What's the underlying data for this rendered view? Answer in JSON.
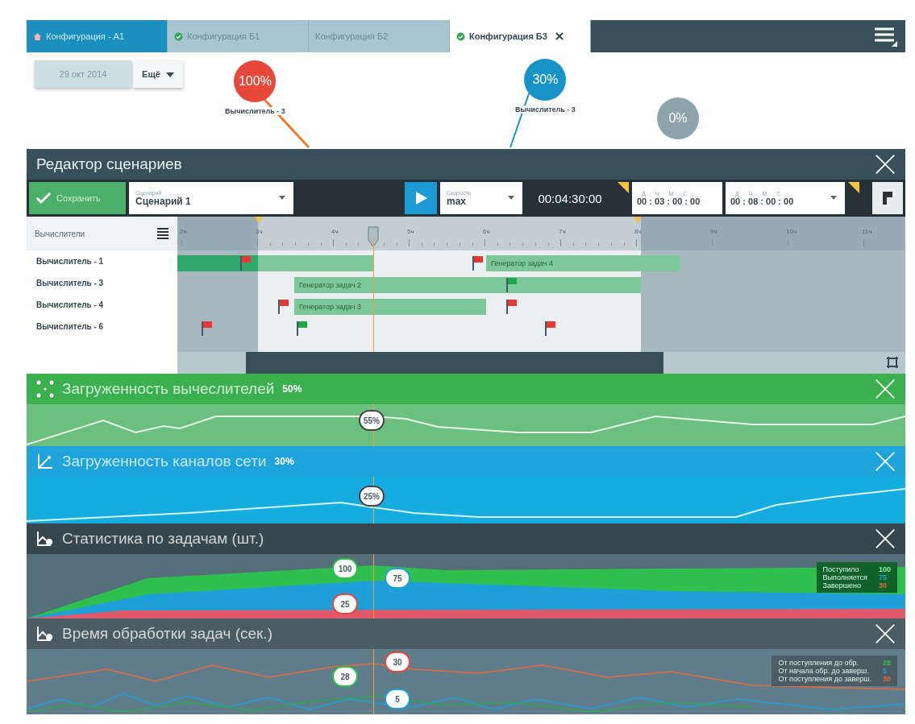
{
  "tabs": [
    {
      "label": "Конфигурация - А1",
      "kind": "alert",
      "selected": false,
      "closable": false
    },
    {
      "label": "Конфигурация Б1",
      "kind": "ok",
      "selected": false,
      "closable": false
    },
    {
      "label": "Конфигурация Б2",
      "kind": "none",
      "selected": false,
      "closable": false
    },
    {
      "label": "Конфигурация Б3",
      "kind": "ok",
      "selected": true,
      "closable": true
    }
  ],
  "date_button": "29 окт 2014",
  "more_button": "Ещё",
  "markers": [
    {
      "value": "100%",
      "label": "Вычислитель - 3",
      "color": "#e8483b"
    },
    {
      "value": "30%",
      "label": "Вычислитель - 3",
      "color": "#1793c8"
    },
    {
      "value": "0%",
      "color": "#8fa3ad"
    }
  ],
  "editor": {
    "title": "Редактор сценариев",
    "save_button": "Сохранить",
    "scenario": {
      "label": "Сценарий",
      "value": "Сценарий 1"
    },
    "speed": {
      "label": "Скорость",
      "value": "max"
    },
    "elapsed": "00:04:30:00",
    "range_start_units": [
      "Д",
      "Ч",
      "М",
      "С"
    ],
    "range_end_units": [
      "Д",
      "Ч",
      "М",
      "С"
    ],
    "range_start": "00 : 03 : 00 : 00",
    "range_end": "00 : 08 : 00 : 00",
    "list_header": "Вычислители",
    "hours": [
      "2ч",
      "3ч",
      "4ч",
      "5ч",
      "6ч",
      "7ч",
      "8ч",
      "9ч",
      "10ч",
      "11ч"
    ],
    "rows": [
      {
        "name": "Вычислитель - 1",
        "bars": [
          {
            "kind": "dark"
          },
          {
            "kind": "light"
          },
          {
            "kind": "light",
            "label": "Генератор задач 4"
          }
        ],
        "flags": [
          {
            "color": "#e53935"
          },
          {
            "color": "#e53935"
          }
        ]
      },
      {
        "name": "Вычислитель - 3",
        "bars": [
          {
            "kind": "light",
            "label": "Генератор задач 2"
          }
        ],
        "flags": [
          {
            "color": "#1ea84a"
          }
        ]
      },
      {
        "name": "Вычислитель - 4",
        "bars": [
          {
            "kind": "light",
            "label": "Генератор задач 3"
          }
        ],
        "flags": [
          {
            "color": "#e53935"
          },
          {
            "color": "#e53935"
          }
        ]
      },
      {
        "name": "Вычислитель - 6",
        "bars": [],
        "flags": [
          {
            "color": "#e53935"
          },
          {
            "color": "#1ea84a"
          },
          {
            "color": "#e53935"
          }
        ]
      }
    ]
  },
  "panels": [
    {
      "kind": "cpu",
      "title": "Загруженность вычеслителей",
      "value": "50%",
      "points": [
        "55%"
      ]
    },
    {
      "kind": "net",
      "title": "Загруженность каналов сети",
      "value": "30%",
      "points": [
        "25%"
      ]
    },
    {
      "kind": "tasks",
      "title": "Статистика по задачам (шт.)",
      "points": [
        "100",
        "75",
        "25"
      ],
      "legend": [
        {
          "label": "Поступило",
          "value": "100",
          "color": "#8ef0a0"
        },
        {
          "label": "Выполняется",
          "value": "75",
          "color": "#1e9fd8"
        },
        {
          "label": "Завершено",
          "value": "30",
          "color": "#e86a3a"
        }
      ]
    },
    {
      "kind": "time",
      "title": "Время обработки задач (сек.)",
      "points": [
        "28",
        "30",
        "5"
      ],
      "legend": [
        {
          "label": "От поступления до обр.",
          "value": "28",
          "color": "#2fbf4f"
        },
        {
          "label": "От начала обр. до заверш.",
          "value": "5",
          "color": "#1e9fd8"
        },
        {
          "label": "От поступления до заверш.",
          "value": "30",
          "color": "#e86a3a"
        }
      ]
    }
  ]
}
